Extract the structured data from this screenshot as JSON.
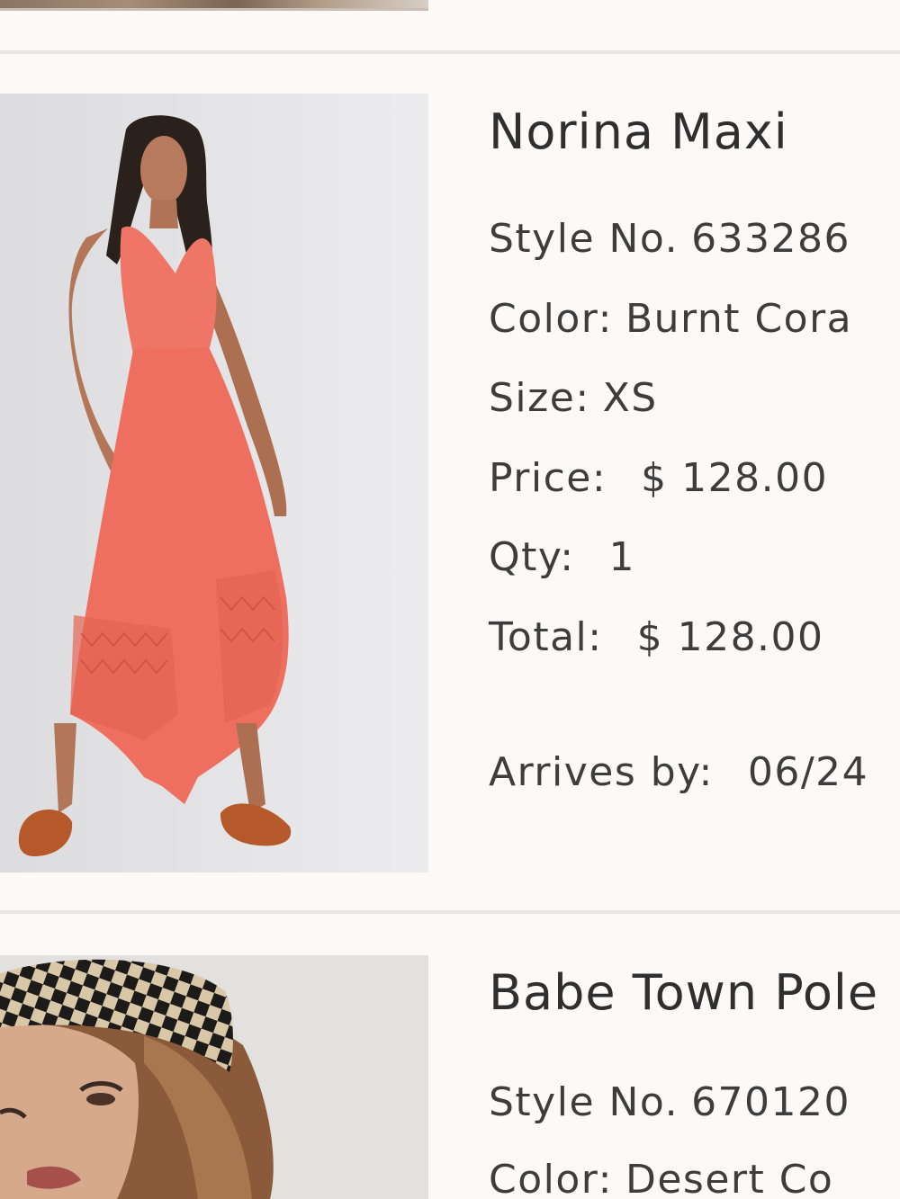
{
  "items": [
    {
      "name": "Norina Maxi",
      "style_label": "Style No.",
      "style_no": "633286",
      "color_label": "Color:",
      "color": "Burnt Cora",
      "size_label": "Size:",
      "size": "XS",
      "price_label": "Price:",
      "price": "$ 128.00",
      "qty_label": "Qty:",
      "qty": "1",
      "total_label": "Total:",
      "total": "$ 128.00",
      "arrives_label": "Arrives by:",
      "arrives": "06/24",
      "image_description": "Model in coral halter maxi dress with orange sandals"
    },
    {
      "name": "Babe Town Pole",
      "style_label": "Style No.",
      "style_no": "670120",
      "color_label": "Color:",
      "color": "Desert Co",
      "image_description": "Model wearing black and tan checkered headscarf"
    }
  ],
  "colors": {
    "background": "#fcf9f7",
    "divider": "#ebe6e2",
    "dress": "#ef7566",
    "text": "#3a3a3a"
  }
}
